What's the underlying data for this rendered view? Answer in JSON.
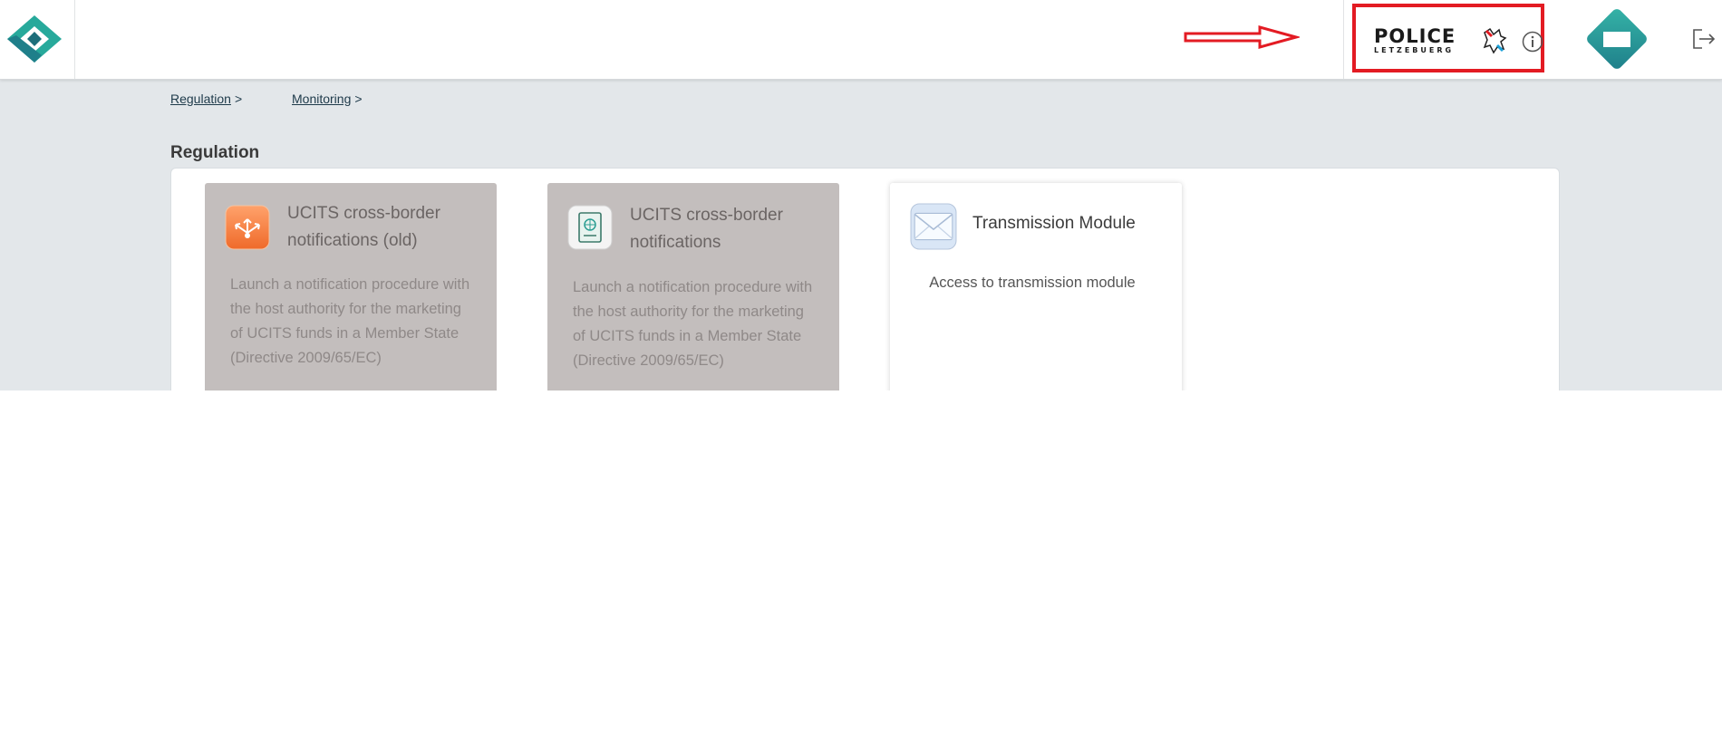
{
  "header": {
    "app_logo_icon": "app-logo-diamond",
    "annotation": "red-arrow-pointing-right",
    "partner_logo": {
      "main_text": "POLICE",
      "sub_text": "LETZEBUERG",
      "highlight_color": "#e31b23"
    },
    "info_icon": "info-circle-icon",
    "user_badge_icon": "user-diamond-badge",
    "logout_icon": "logout-icon"
  },
  "breadcrumb": [
    {
      "label": "Regulation",
      "separator": ">"
    },
    {
      "label": "Monitoring",
      "separator": ">"
    }
  ],
  "section": {
    "title": "Regulation",
    "cards": [
      {
        "title": "UCITS cross-border notifications (old)",
        "description": "Launch a notification procedure with the host authority for the marketing of UCITS funds in a Member State (Directive 2009/65/EC)",
        "icon": "share-network-icon",
        "state": "disabled"
      },
      {
        "title": "UCITS cross-border notifications",
        "description": "Launch a notification procedure with the host authority for the marketing of UCITS funds in a Member State (Directive 2009/65/EC)",
        "icon": "passport-icon",
        "state": "disabled"
      },
      {
        "title": "Transmission Module",
        "description": "Access to transmission module",
        "icon": "envelope-icon",
        "state": "active"
      }
    ]
  },
  "colors": {
    "teal": "#2a9d92",
    "background_band": "#e3e7ea",
    "disabled_card": "#c3bebd",
    "annotation_red": "#e31b23"
  }
}
